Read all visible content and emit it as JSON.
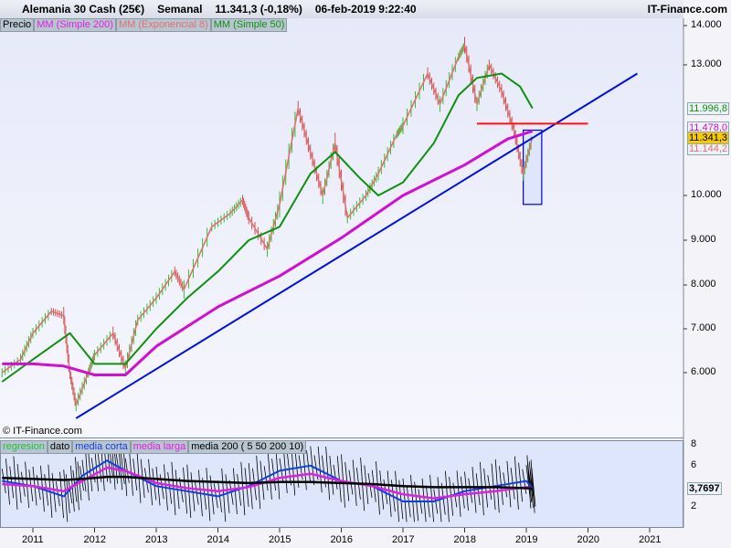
{
  "header": {
    "instrument": "Alemania 30 Cash (25€)",
    "period": "Semanal",
    "price": "11.341,3 (-0,18%)",
    "datetime": "06-feb-2019 9:22:40",
    "brand": "IT-Finance.com"
  },
  "legend": [
    {
      "label": "Precio",
      "color": "#000000"
    },
    {
      "label": "MM (Simple 200)",
      "color": "#e020e0"
    },
    {
      "label": "MM (Exponencial 8)",
      "color": "#e07070"
    },
    {
      "label": "MM (Simple 50)",
      "color": "#109010"
    }
  ],
  "copyright": "© IT-Finance.com",
  "indicator_legend": [
    {
      "label": "regresion",
      "color": "#20c040"
    },
    {
      "label": "dato",
      "color": "#000000"
    },
    {
      "label": "media corta",
      "color": "#1040e0"
    },
    {
      "label": "media larga",
      "color": "#e020e0"
    },
    {
      "label": "media 200 ( 5 50 200 10)",
      "color": "#000000"
    }
  ],
  "price_axis": [
    "14.000",
    "13.000",
    "10.000",
    "9.000",
    "8.000",
    "7.000",
    "6.000"
  ],
  "price_labels": {
    "ma50": "11.996,8",
    "ma200": "11.478,0",
    "last": "11.341,3",
    "ema8": "11.144,2"
  },
  "indicator_axis": [
    "8",
    "6",
    "2"
  ],
  "indicator_value": "3,7697",
  "years": [
    "2011",
    "2012",
    "2013",
    "2014",
    "2015",
    "2016",
    "2017",
    "2018",
    "2019",
    "2020",
    "2021"
  ],
  "chart_data": {
    "type": "line",
    "price": {
      "x": [
        2010.5,
        2010.8,
        2011.0,
        2011.3,
        2011.5,
        2011.6,
        2011.7,
        2011.9,
        2012.0,
        2012.3,
        2012.5,
        2012.7,
        2013.0,
        2013.3,
        2013.45,
        2013.9,
        2014.2,
        2014.4,
        2014.5,
        2014.8,
        2015.0,
        2015.3,
        2015.5,
        2015.7,
        2015.9,
        2016.1,
        2016.4,
        2016.6,
        2016.9,
        2017.0,
        2017.4,
        2017.6,
        2017.9,
        2018.0,
        2018.2,
        2018.4,
        2018.6,
        2018.8,
        2018.95,
        2019.1
      ],
      "y": [
        6000,
        6300,
        6900,
        7400,
        7300,
        6000,
        5300,
        6000,
        6400,
        6900,
        6100,
        7200,
        7700,
        8300,
        7900,
        9300,
        9600,
        9900,
        9500,
        8800,
        9800,
        12000,
        11000,
        10000,
        11200,
        9500,
        10000,
        10500,
        11400,
        11600,
        12800,
        12100,
        13200,
        13500,
        12100,
        13000,
        12400,
        11500,
        10500,
        11341
      ]
    },
    "ma50": {
      "x": [
        2010.5,
        2011.0,
        2011.6,
        2012.0,
        2012.5,
        2013.0,
        2013.5,
        2014.0,
        2014.5,
        2015.0,
        2015.5,
        2015.9,
        2016.3,
        2016.6,
        2017.0,
        2017.5,
        2017.9,
        2018.2,
        2018.6,
        2018.9,
        2019.1
      ],
      "y": [
        5800,
        6300,
        6900,
        6200,
        6200,
        7000,
        7700,
        8300,
        9000,
        9300,
        10500,
        11000,
        10400,
        10000,
        10300,
        11200,
        12300,
        12700,
        12800,
        12500,
        12000
      ]
    },
    "ma200": {
      "x": [
        2010.5,
        2011.0,
        2011.5,
        2012.0,
        2012.5,
        2013.0,
        2014.0,
        2015.0,
        2016.0,
        2017.0,
        2018.0,
        2018.7,
        2019.1
      ],
      "y": [
        6200,
        6200,
        6150,
        5950,
        5950,
        6600,
        7500,
        8200,
        9050,
        10000,
        10700,
        11300,
        11478
      ]
    },
    "trendline": {
      "x": [
        2011.7,
        2020.8
      ],
      "y": [
        5000,
        12800
      ]
    },
    "resistance": {
      "x": [
        2018.2,
        2020.0
      ],
      "y": [
        11650,
        11650
      ]
    },
    "zone": {
      "x": [
        2018.95,
        2019.25
      ],
      "y": [
        9800,
        11500
      ]
    },
    "indicator": {
      "x": [
        2010.5,
        2011.0,
        2011.5,
        2011.8,
        2012.2,
        2012.5,
        2013.0,
        2013.5,
        2014.0,
        2014.5,
        2015.0,
        2015.5,
        2016.0,
        2016.5,
        2017.0,
        2017.5,
        2018.0,
        2018.5,
        2019.0,
        2019.1
      ],
      "media_corta": [
        4.5,
        4.0,
        3.0,
        5.0,
        6.5,
        5.5,
        4.0,
        3.5,
        3.0,
        4.0,
        5.5,
        6.0,
        4.5,
        4.0,
        2.5,
        2.5,
        3.5,
        4.0,
        4.5,
        3.8
      ],
      "media_larga": [
        4.2,
        4.0,
        3.5,
        4.5,
        5.8,
        5.5,
        4.3,
        3.8,
        3.5,
        3.9,
        4.8,
        5.2,
        4.5,
        4.0,
        3.2,
        2.8,
        3.2,
        3.5,
        3.9,
        3.77
      ],
      "media_200": [
        4.8,
        4.7,
        4.6,
        4.7,
        4.9,
        4.9,
        4.7,
        4.5,
        4.4,
        4.3,
        4.4,
        4.4,
        4.3,
        4.2,
        4.0,
        3.9,
        3.9,
        3.9,
        3.8,
        3.77
      ],
      "ylim": [
        0,
        8.5
      ]
    }
  }
}
